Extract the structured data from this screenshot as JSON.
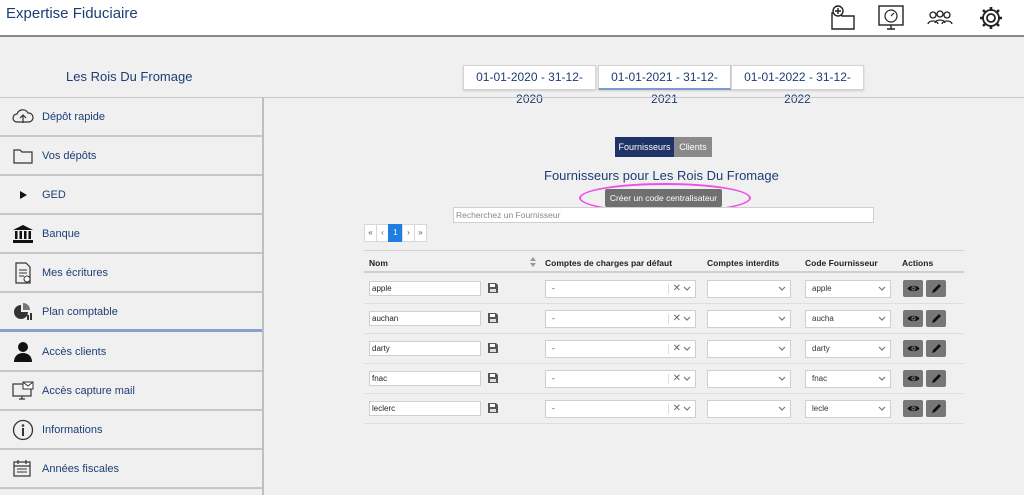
{
  "app": {
    "title": "Expertise Fiduciaire"
  },
  "top_icons": [
    "folder-add-icon",
    "dashboard-icon",
    "users-icon",
    "gear-icon"
  ],
  "company": "Les Rois Du Fromage",
  "fiscal_years": [
    {
      "label": "01-01-2020 - 31-12-2020",
      "active": false
    },
    {
      "label": "01-01-2021 - 31-12-2021",
      "active": true
    },
    {
      "label": "01-01-2022 - 31-12-2022",
      "active": false
    }
  ],
  "sidebar": {
    "items": [
      {
        "label": "Dépôt rapide",
        "icon": "cloud-upload-icon"
      },
      {
        "label": "Vos dépôts",
        "icon": "folder-icon"
      },
      {
        "label": "GED",
        "icon": "play-icon"
      },
      {
        "label": "Banque",
        "icon": "bank-icon"
      },
      {
        "label": "Mes écritures",
        "icon": "document-icon"
      },
      {
        "label": "Plan comptable",
        "icon": "chart-icon",
        "selected": true
      },
      {
        "label": "Accès clients",
        "icon": "person-icon"
      },
      {
        "label": "Accès capture mail",
        "icon": "mail-capture-icon"
      },
      {
        "label": "Informations",
        "icon": "info-icon"
      },
      {
        "label": "Années fiscales",
        "icon": "calendar-icon"
      }
    ]
  },
  "tabs": {
    "suppliers": "Fournisseurs",
    "clients": "Clients"
  },
  "heading": "Fournisseurs pour Les Rois Du Fromage",
  "create_button": "Créer un code centralisateur",
  "search": {
    "placeholder": "Recherchez un Fournisseur",
    "value": ""
  },
  "pagination": {
    "first": "«",
    "prev": "‹",
    "current": "1",
    "next": "›",
    "last": "»"
  },
  "table": {
    "headers": {
      "name": "Nom",
      "default_accounts": "Comptes de charges par défaut",
      "forbidden_accounts": "Comptes interdits",
      "supplier_code": "Code Fournisseur",
      "actions": "Actions"
    },
    "rows": [
      {
        "name": "apple",
        "default_account": "-",
        "forbidden": "",
        "code": "apple"
      },
      {
        "name": "auchan",
        "default_account": "-",
        "forbidden": "",
        "code": "aucha"
      },
      {
        "name": "darty",
        "default_account": "-",
        "forbidden": "",
        "code": "darty"
      },
      {
        "name": "fnac",
        "default_account": "-",
        "forbidden": "",
        "code": "fnac"
      },
      {
        "name": "leclerc",
        "default_account": "-",
        "forbidden": "",
        "code": "lecle"
      }
    ]
  },
  "colors": {
    "brand": "#1d3d74",
    "tab_active": "#1f3366",
    "page_active": "#1e7fe0",
    "highlight": "#ee4ee6"
  }
}
